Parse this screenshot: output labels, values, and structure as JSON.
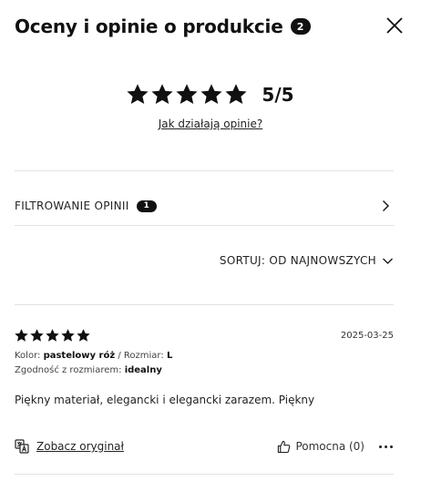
{
  "header": {
    "title": "Oceny i opinie o produkcie",
    "review_count": "2"
  },
  "summary": {
    "rating": 5,
    "rating_max": 5,
    "score_label": "5/5",
    "how_link": "Jak działają opinie?"
  },
  "filter": {
    "label": "FILTROWANIE OPINII",
    "count": "1"
  },
  "sort": {
    "label": "SORTUJ: OD NAJNOWSZYCH"
  },
  "review": {
    "rating": 5,
    "date": "2025-03-25",
    "color_label": "Kolor:",
    "color_value": "pastelowy róż",
    "size_separator": "/",
    "size_label": "Rozmiar:",
    "size_value": "L",
    "fit_label": "Zgodność z rozmiarem:",
    "fit_value": "idealny",
    "text": "Piękny materiał, elegancki i elegancki zarazem. Piękny",
    "see_original": "Zobacz oryginał",
    "helpful_label": "Pomocna (0)"
  },
  "icons": {
    "close": "close-icon",
    "star": "star-icon",
    "chevron_right": "chevron-right-icon",
    "chevron_down": "chevron-down-icon",
    "translate": "translate-icon",
    "thumb_up": "thumb-up-icon",
    "more": "more-icon"
  },
  "colors": {
    "text": "#111111",
    "divider": "#e2e2e2",
    "badge": "#111111"
  }
}
